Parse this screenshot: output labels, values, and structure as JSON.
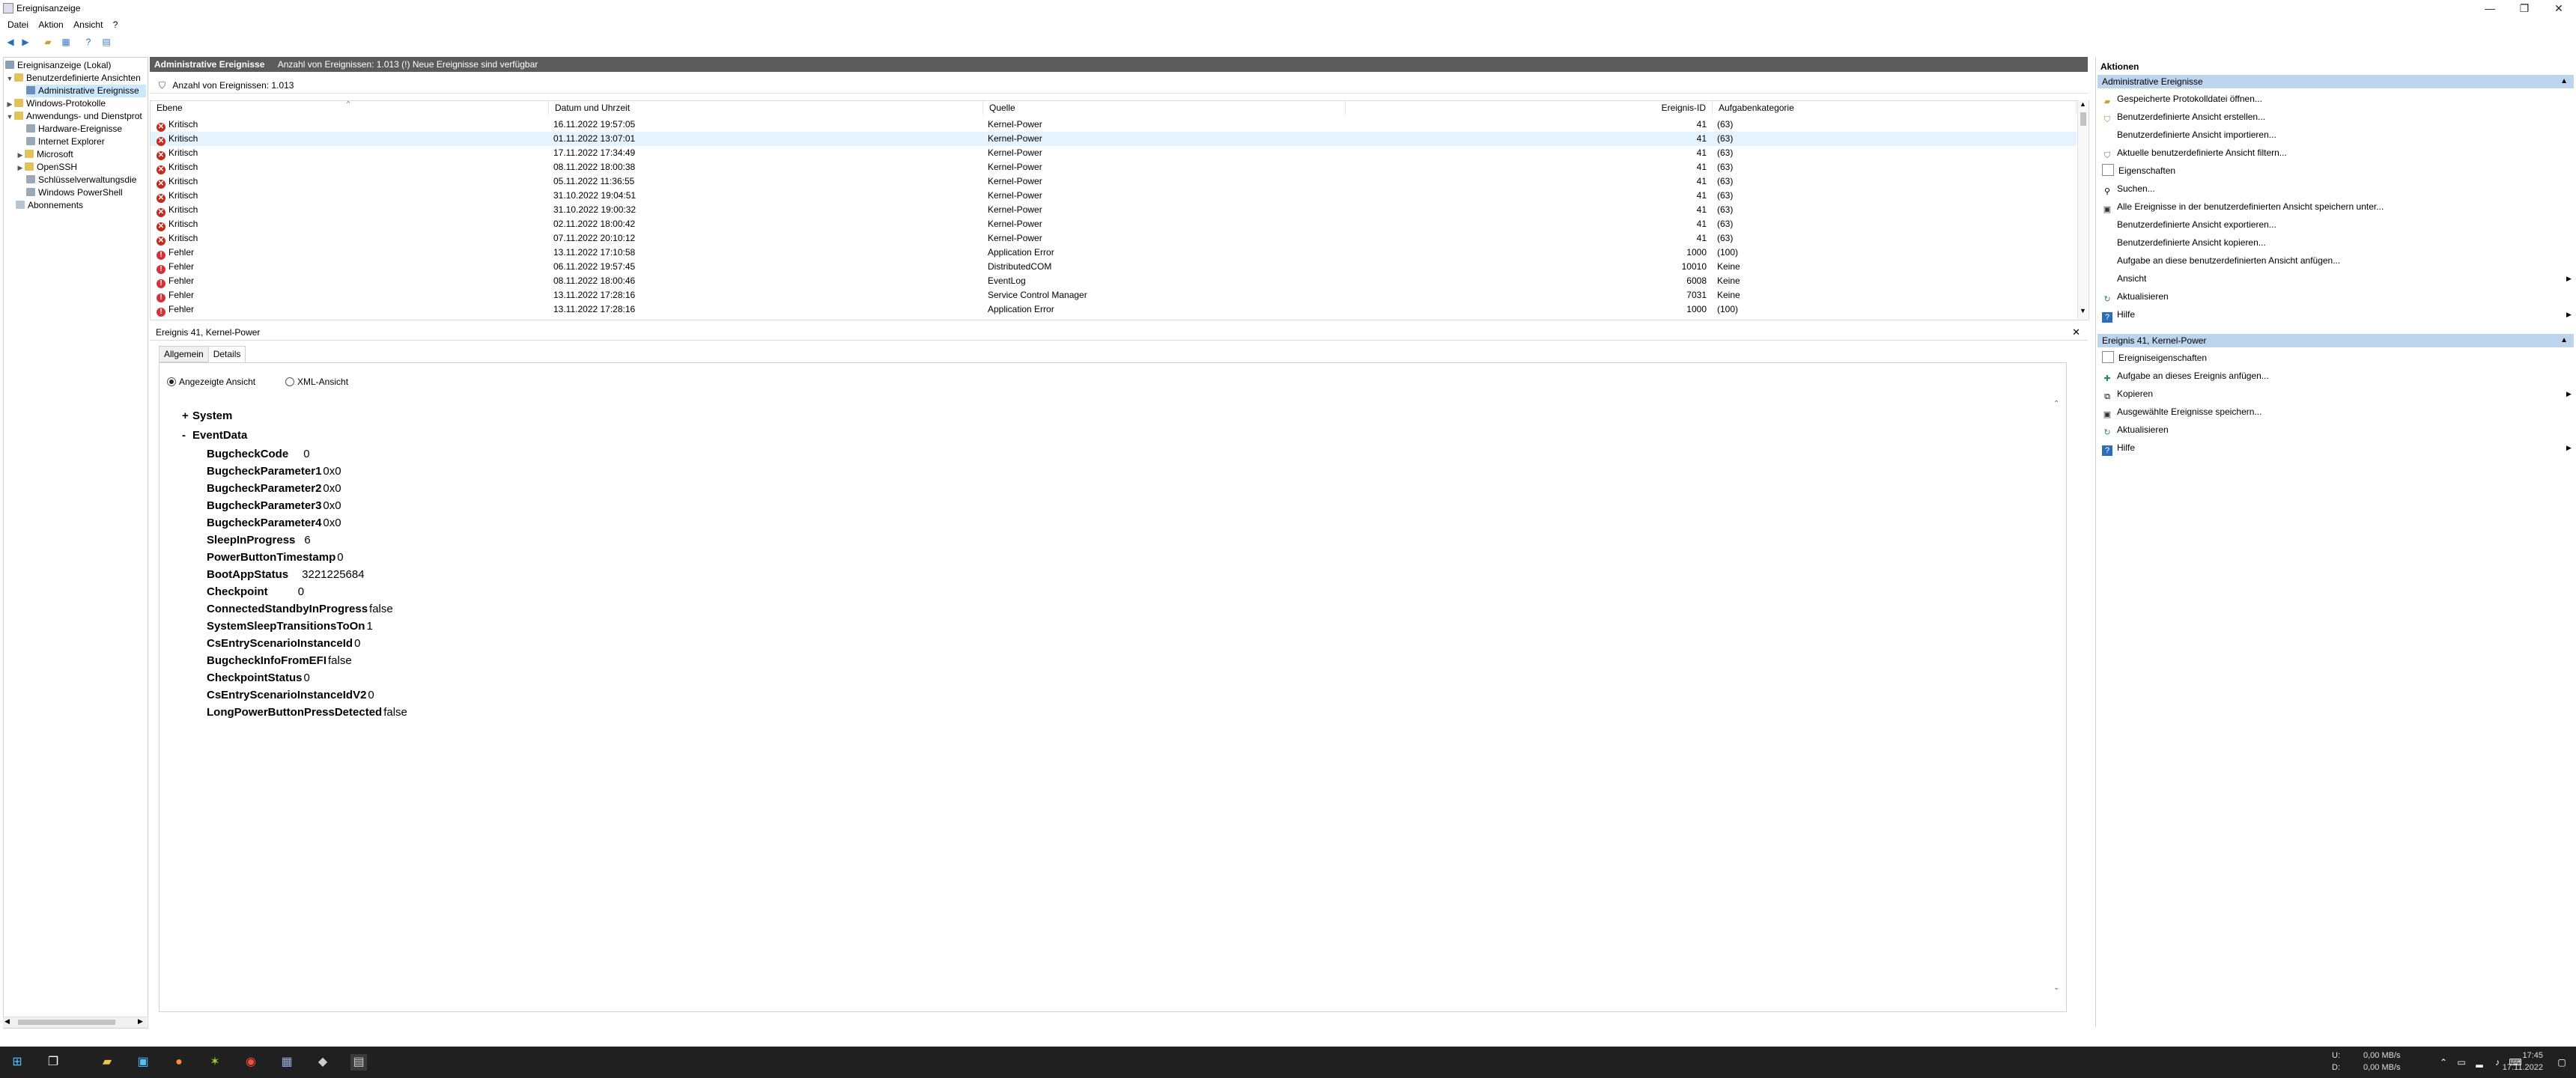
{
  "window": {
    "title": "Ereignisanzeige",
    "minimize": "—",
    "restore": "❐",
    "close": "✕"
  },
  "menu": [
    "Datei",
    "Aktion",
    "Ansicht",
    "?"
  ],
  "toolbar_icons": [
    "back-arrow-icon",
    "forward-arrow-icon",
    "folder-icon",
    "view-icon",
    "help-icon",
    "console-icon"
  ],
  "tree": {
    "root": "Ereignisanzeige (Lokal)",
    "custom_views": "Benutzerdefinierte Ansichten",
    "admin_events": "Administrative Ereignisse",
    "windows_logs": "Windows-Protokolle",
    "app_logs": "Anwendungs- und Dienstprot",
    "hardware": "Hardware-Ereignisse",
    "ie": "Internet Explorer",
    "microsoft": "Microsoft",
    "openssh": "OpenSSH",
    "keymgmt": "Schlüsselverwaltungsdie",
    "powershell": "Windows PowerShell",
    "subscriptions": "Abonnements"
  },
  "center": {
    "header_title": "Administrative Ereignisse",
    "header_info": "Anzahl von Ereignissen: 1.013 (!) Neue Ereignisse sind verfügbar",
    "filter_info": "Anzahl von Ereignissen: 1.013",
    "columns": {
      "level": "Ebene",
      "date": "Datum und Uhrzeit",
      "source": "Quelle",
      "event_id": "Ereignis-ID",
      "task": "Aufgabenkategorie"
    },
    "rows": [
      {
        "level": "Kritisch",
        "date": "16.11.2022 19:57:05",
        "source": "Kernel-Power",
        "id": "41",
        "task": "(63)"
      },
      {
        "level": "Kritisch",
        "date": "01.11.2022 13:07:01",
        "source": "Kernel-Power",
        "id": "41",
        "task": "(63)"
      },
      {
        "level": "Kritisch",
        "date": "17.11.2022 17:34:49",
        "source": "Kernel-Power",
        "id": "41",
        "task": "(63)"
      },
      {
        "level": "Kritisch",
        "date": "08.11.2022 18:00:38",
        "source": "Kernel-Power",
        "id": "41",
        "task": "(63)"
      },
      {
        "level": "Kritisch",
        "date": "05.11.2022 11:36:55",
        "source": "Kernel-Power",
        "id": "41",
        "task": "(63)"
      },
      {
        "level": "Kritisch",
        "date": "31.10.2022 19:04:51",
        "source": "Kernel-Power",
        "id": "41",
        "task": "(63)"
      },
      {
        "level": "Kritisch",
        "date": "31.10.2022 19:00:32",
        "source": "Kernel-Power",
        "id": "41",
        "task": "(63)"
      },
      {
        "level": "Kritisch",
        "date": "02.11.2022 18:00:42",
        "source": "Kernel-Power",
        "id": "41",
        "task": "(63)"
      },
      {
        "level": "Kritisch",
        "date": "07.11.2022 20:10:12",
        "source": "Kernel-Power",
        "id": "41",
        "task": "(63)"
      },
      {
        "level": "Fehler",
        "date": "13.11.2022 17:10:58",
        "source": "Application Error",
        "id": "1000",
        "task": "(100)"
      },
      {
        "level": "Fehler",
        "date": "06.11.2022 19:57:45",
        "source": "DistributedCOM",
        "id": "10010",
        "task": "Keine"
      },
      {
        "level": "Fehler",
        "date": "08.11.2022 18:00:46",
        "source": "EventLog",
        "id": "6008",
        "task": "Keine"
      },
      {
        "level": "Fehler",
        "date": "13.11.2022 17:28:16",
        "source": "Service Control Manager",
        "id": "7031",
        "task": "Keine"
      },
      {
        "level": "Fehler",
        "date": "13.11.2022 17:28:16",
        "source": "Application Error",
        "id": "1000",
        "task": "(100)"
      }
    ]
  },
  "detail": {
    "title": "Ereignis 41, Kernel-Power",
    "close": "✕",
    "tabs": [
      "Allgemein",
      "Details"
    ],
    "radio_friendly": "Angezeigte Ansicht",
    "radio_xml": "XML-Ansicht",
    "system_expander": "+",
    "system": "System",
    "eventdata_expander": "-",
    "eventdata": "EventData",
    "fields": [
      {
        "k": "BugcheckCode",
        "v": "0"
      },
      {
        "k": "BugcheckParameter1",
        "v": "0x0"
      },
      {
        "k": "BugcheckParameter2",
        "v": "0x0"
      },
      {
        "k": "BugcheckParameter3",
        "v": "0x0"
      },
      {
        "k": "BugcheckParameter4",
        "v": "0x0"
      },
      {
        "k": "SleepInProgress",
        "v": "6"
      },
      {
        "k": "PowerButtonTimestamp",
        "v": "0"
      },
      {
        "k": "BootAppStatus",
        "v": "3221225684"
      },
      {
        "k": "Checkpoint",
        "v": "0"
      },
      {
        "k": "ConnectedStandbyInProgress",
        "v": "false"
      },
      {
        "k": "SystemSleepTransitionsToOn",
        "v": "1"
      },
      {
        "k": "CsEntryScenarioInstanceId",
        "v": "0"
      },
      {
        "k": "BugcheckInfoFromEFI",
        "v": "false"
      },
      {
        "k": "CheckpointStatus",
        "v": "0"
      },
      {
        "k": "CsEntryScenarioInstanceIdV2",
        "v": "0"
      },
      {
        "k": "LongPowerButtonPressDetected",
        "v": "false"
      }
    ]
  },
  "actions": {
    "title": "Aktionen",
    "section1": "Administrative Ereignisse",
    "items1": [
      {
        "label": "Gespeicherte Protokolldatei öffnen...",
        "icon": "open-log-icon"
      },
      {
        "label": "Benutzerdefinierte Ansicht erstellen...",
        "icon": "filter-icon"
      },
      {
        "label": "Benutzerdefinierte Ansicht importieren...",
        "icon": ""
      },
      {
        "label": "Aktuelle benutzerdefinierte Ansicht filtern...",
        "icon": "filter-icon"
      },
      {
        "label": "Eigenschaften",
        "icon": "properties-icon"
      },
      {
        "label": "Suchen...",
        "icon": "find-icon"
      },
      {
        "label": "Alle Ereignisse in der benutzerdefinierten Ansicht speichern unter...",
        "icon": "save-icon"
      },
      {
        "label": "Benutzerdefinierte Ansicht exportieren...",
        "icon": ""
      },
      {
        "label": "Benutzerdefinierte Ansicht kopieren...",
        "icon": ""
      },
      {
        "label": "Aufgabe an diese benutzerdefinierten Ansicht anfügen...",
        "icon": ""
      },
      {
        "label": "Ansicht",
        "icon": "",
        "submenu": true
      },
      {
        "label": "Aktualisieren",
        "icon": "refresh-icon"
      },
      {
        "label": "Hilfe",
        "icon": "help-icon",
        "submenu": true
      }
    ],
    "section2": "Ereignis 41, Kernel-Power",
    "items2": [
      {
        "label": "Ereigniseigenschaften",
        "icon": "event-properties-icon"
      },
      {
        "label": "Aufgabe an dieses Ereignis anfügen...",
        "icon": "task-icon"
      },
      {
        "label": "Kopieren",
        "icon": "copy-icon",
        "submenu": true
      },
      {
        "label": "Ausgewählte Ereignisse speichern...",
        "icon": "save-icon"
      },
      {
        "label": "Aktualisieren",
        "icon": "refresh-icon"
      },
      {
        "label": "Hilfe",
        "icon": "help-icon",
        "submenu": true
      }
    ]
  },
  "taskbar": {
    "net_u": "U:",
    "net_d": "D:",
    "net_u_val": "0,00 MB/s",
    "net_d_val": "0,00 MB/s",
    "time": "17:45",
    "date": "17.11.2022"
  },
  "colors": {
    "header_bg": "#5c5c5c",
    "action_section_bg": "#bcd4ec",
    "critical": "#c42b1c",
    "selected": "#cce8ff",
    "taskbar": "#202020"
  }
}
